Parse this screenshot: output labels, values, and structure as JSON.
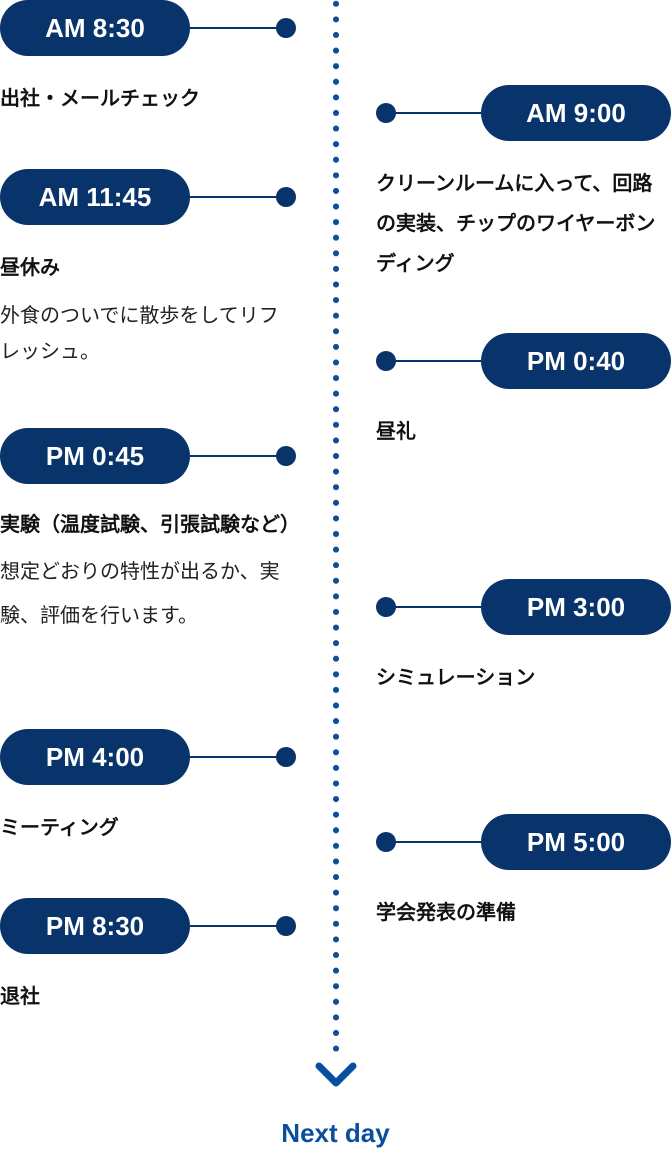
{
  "colors": {
    "pill": "#08336b",
    "accent": "#0a4f9e"
  },
  "left": [
    {
      "time": "AM 8:30",
      "title": "出社・メールチェック"
    },
    {
      "time": "AM 11:45",
      "title": "昼休み",
      "desc": "外食のついでに散歩をしてリフレッシュ。"
    },
    {
      "time": "PM 0:45",
      "title": "実験（温度試験、引張試験など）",
      "desc": "想定どおりの特性が出るか、実験、評価を行います。"
    },
    {
      "time": "PM 4:00",
      "title": "ミーティング"
    },
    {
      "time": "PM 8:30",
      "title": "退社"
    }
  ],
  "right": [
    {
      "time": "AM 9:00",
      "title": "クリーンルームに入って、回路の実装、チップのワイヤーボンディング"
    },
    {
      "time": "PM 0:40",
      "title": "昼礼"
    },
    {
      "time": "PM 3:00",
      "title": "シミュレーション"
    },
    {
      "time": "PM 5:00",
      "title": "学会発表の準備"
    }
  ],
  "footer": {
    "next_label": "Next day",
    "icon": "chevron-down-icon"
  }
}
